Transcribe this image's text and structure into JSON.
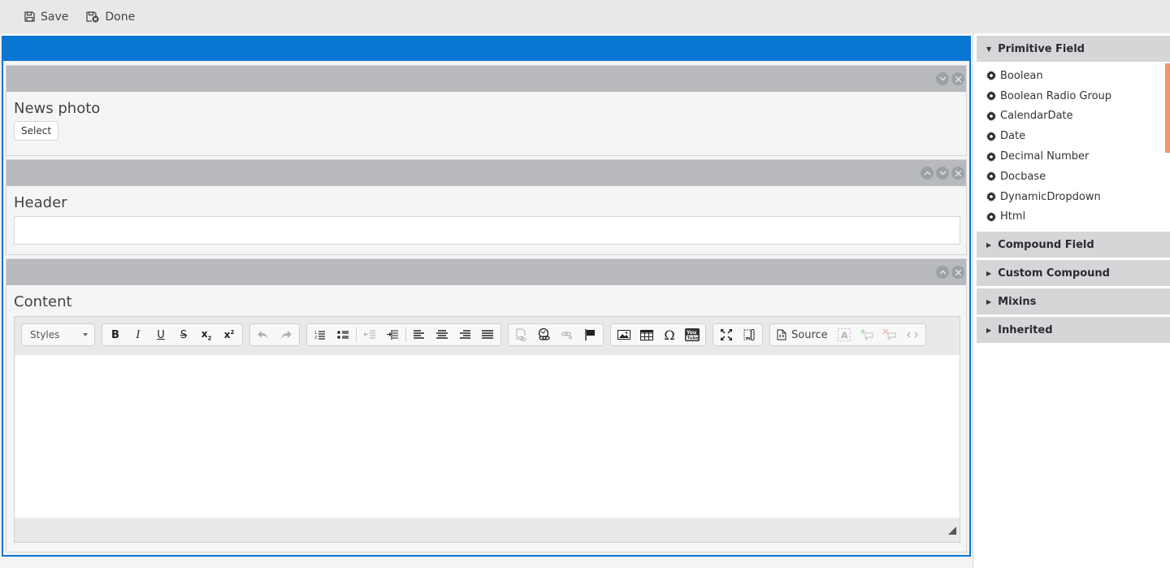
{
  "toolbar": {
    "save_label": "Save",
    "done_label": "Done"
  },
  "fields": {
    "news_photo": {
      "label": "News photo",
      "select_label": "Select"
    },
    "header": {
      "label": "Header",
      "value": ""
    },
    "content": {
      "label": "Content"
    }
  },
  "editor": {
    "styles_label": "Styles",
    "source_label": "Source"
  },
  "palette": {
    "primitive": {
      "title": "Primitive Field",
      "items": [
        "Boolean",
        "Boolean Radio Group",
        "CalendarDate",
        "Date",
        "Decimal Number",
        "Docbase",
        "DynamicDropdown",
        "Html"
      ]
    },
    "sections": [
      "Compound Field",
      "Custom Compound",
      "Mixins",
      "Inherited"
    ]
  },
  "colors": {
    "accent": "#0a76d3",
    "scroll_indicator": "#f4946a"
  }
}
